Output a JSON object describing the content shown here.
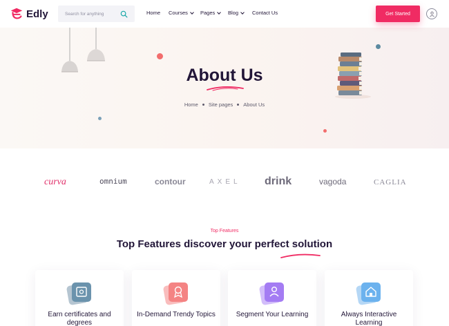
{
  "header": {
    "logo_text": "Edly",
    "search_placeholder": "Search for anything",
    "nav": [
      {
        "label": "Home",
        "has_dropdown": false
      },
      {
        "label": "Courses",
        "has_dropdown": true
      },
      {
        "label": "Pages",
        "has_dropdown": true
      },
      {
        "label": "Blog",
        "has_dropdown": true
      },
      {
        "label": "Contact Us",
        "has_dropdown": false
      }
    ],
    "cta_label": "Get Started",
    "user_icon": "user-icon"
  },
  "hero": {
    "title": "About Us",
    "breadcrumb": [
      "Home",
      "Site pages",
      "About Us"
    ]
  },
  "partners": [
    "curva",
    "omnium",
    "contour",
    "AXEL",
    "drink",
    "vagoda",
    "CAGLIA"
  ],
  "features": {
    "eyebrow": "Top Features",
    "title": "Top Features discover your perfect solution",
    "cards": [
      {
        "title": "Earn certificates and degrees",
        "icon": "certificate-icon",
        "color": "#5c7f9a"
      },
      {
        "title": "In-Demand Trendy Topics",
        "icon": "award-icon",
        "color": "#f26d6d"
      },
      {
        "title": "Segment Your Learning",
        "icon": "user-icon",
        "color": "#9b6cf5"
      },
      {
        "title": "Always Interactive Learning",
        "icon": "home-icon",
        "color": "#5aa7e8"
      }
    ]
  },
  "colors": {
    "brand": "#f02b63",
    "heading": "#221638",
    "hero_bg": "#fbf6f3"
  }
}
